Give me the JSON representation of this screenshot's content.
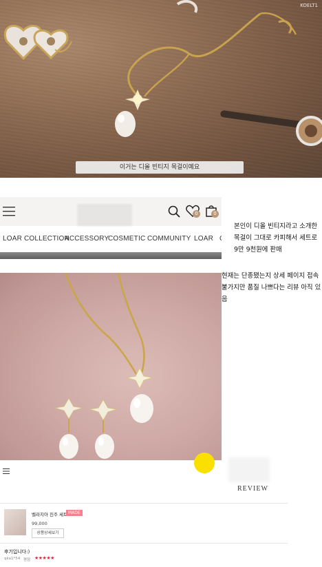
{
  "video": {
    "subtitle": "이거는 디올 빈티지 목걸이예요",
    "watermark": "KOELT1"
  },
  "store": {
    "nav": [
      "LOAR COLLECTION",
      "ACCESSORY",
      "COSMETIC",
      "COMMUNITY",
      "LOAR",
      "C"
    ],
    "wishlist_count": "0",
    "cart_count": "0"
  },
  "captions": {
    "line1": "본인이 디올 빈티지라고 소개한",
    "line2": "목걸이 그대로 카피해서 세트로",
    "line3": "9만 9천원에 판매",
    "line4": "현재는 단종됐는지 상세 페이지 접속",
    "line5": "불가지만 품질 나쁘다는 리뷰 아직 있",
    "line6": "음"
  },
  "review": {
    "tab_label": "REVIEW",
    "product_name": "벨라지아 진주 세트",
    "badge": "MADE",
    "price": "99,000",
    "detail_button": "상품상세보기",
    "title": "후기입니다:)",
    "reviewer": "qka1*54",
    "rating_label": "평점",
    "stars": "★★★★★"
  },
  "colors": {
    "badge": "#f1838b",
    "stars": "#e8233c",
    "kakao": "#f9e000"
  }
}
